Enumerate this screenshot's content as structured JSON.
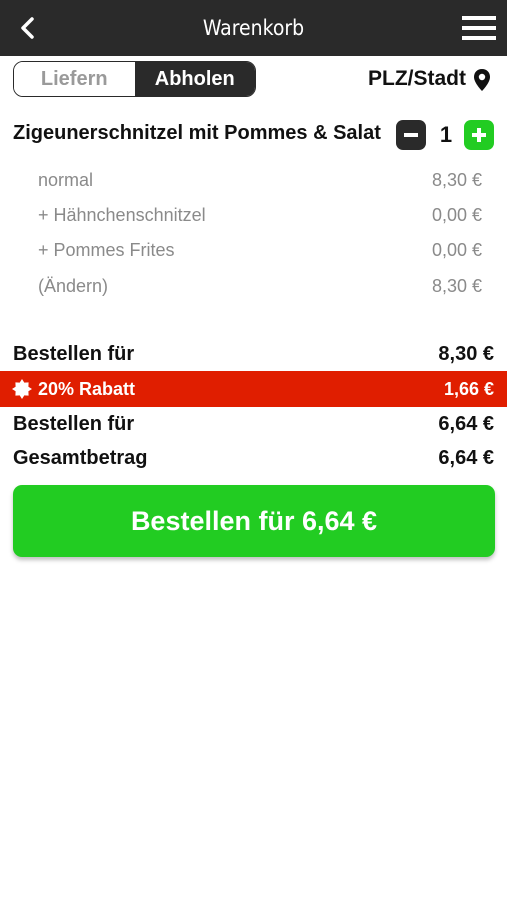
{
  "header": {
    "title": "Warenkorb",
    "back_icon": "chevron-left-icon",
    "menu_icon": "hamburger-menu-icon"
  },
  "mode_toggle": {
    "options": [
      "Liefern",
      "Abholen"
    ],
    "selected": "Abholen"
  },
  "location": {
    "label": "PLZ/Stadt",
    "icon": "map-pin-icon"
  },
  "cart_item": {
    "name": "Zigeunerschnitzel mit Pommes & Salat",
    "quantity": "1",
    "options": [
      {
        "label": "normal",
        "price": "8,30 €"
      },
      {
        "label": "+ Hähnchenschnitzel",
        "price": "0,00 €"
      },
      {
        "label": "+ Pommes Frites",
        "price": "0,00 €"
      },
      {
        "label": "(Ändern)",
        "price": "8,30 €"
      }
    ]
  },
  "summary": {
    "subtotal_label": "Bestellen für",
    "subtotal_value": "8,30 €",
    "discount_label": "20% Rabatt",
    "discount_value": "1,66 €",
    "after_discount_label": "Bestellen für",
    "after_discount_value": "6,64 €",
    "total_label": "Gesamtbetrag",
    "total_value": "6,64 €"
  },
  "order_button": {
    "label": "Bestellen für 6,64 €"
  },
  "colors": {
    "header_bg": "#2a2a2a",
    "accent_green": "#22cc22",
    "discount_red": "#e01e00"
  }
}
